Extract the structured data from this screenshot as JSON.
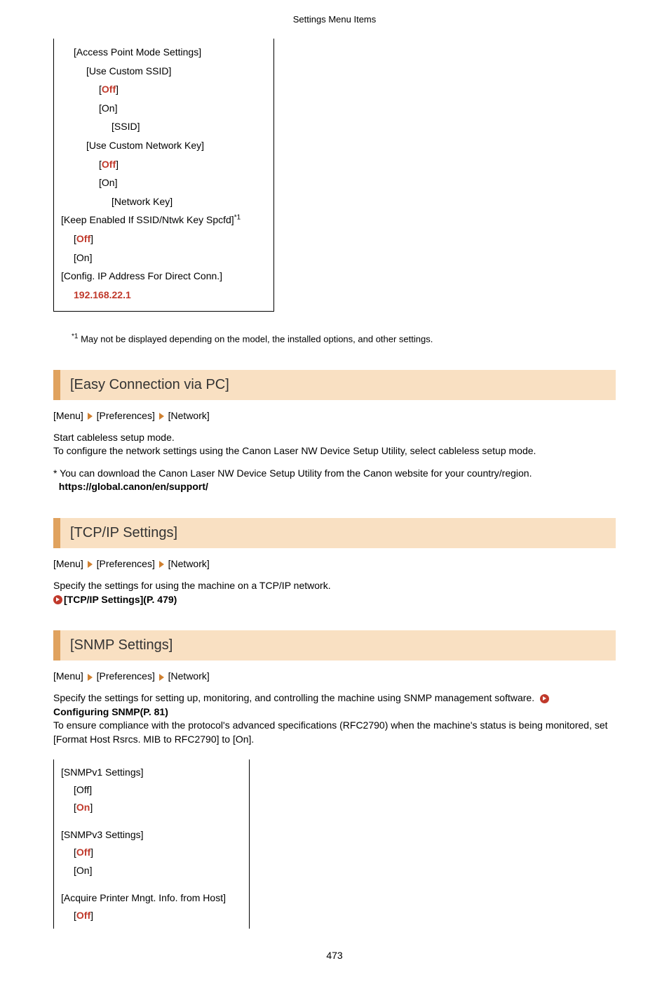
{
  "header": {
    "title": "Settings Menu Items"
  },
  "box1": {
    "l1": "[Access Point Mode Settings]",
    "l2": "[Use Custom SSID]",
    "l3a": "[",
    "l3b": "Off",
    "l3c": "]",
    "l4": "[On]",
    "l5": "[SSID]",
    "l6": "[Use Custom Network Key]",
    "l7a": "[",
    "l7b": "Off",
    "l7c": "]",
    "l8": "[On]",
    "l9": "[Network Key]",
    "l10a": "[Keep Enabled If SSID/Ntwk Key Spcfd]",
    "l10sup": "*1",
    "l11a": "[",
    "l11b": "Off",
    "l11c": "]",
    "l12": "[On]",
    "l13": "[Config. IP Address For Direct Conn.]",
    "l14": "192.168.22.1"
  },
  "footnote": {
    "sup": "*1",
    "text": " May not be displayed depending on the model, the installed options, and other settings."
  },
  "breadcrumb": {
    "a": "[Menu]",
    "b": "[Preferences]",
    "c": "[Network]"
  },
  "sec1": {
    "title": "[Easy Connection via PC]",
    "p1": "Start cableless setup mode.",
    "p2": "To configure the network settings using the Canon Laser NW Device Setup Utility, select cableless setup mode.",
    "p3": "* You can download the Canon Laser NW Device Setup Utility from the Canon website for your country/region.",
    "p4": "https://global.canon/en/support/"
  },
  "sec2": {
    "title": "[TCP/IP Settings]",
    "p1": "Specify the settings for using the machine on a TCP/IP network.",
    "link": "[TCP/IP Settings](P. 479)"
  },
  "sec3": {
    "title": "[SNMP Settings]",
    "p1a": "Specify the settings for setting up, monitoring, and controlling the machine using SNMP management software. ",
    "link": "Configuring SNMP(P. 81)",
    "p2": "To ensure compliance with the protocol's advanced specifications (RFC2790) when the machine's status is being monitored, set [Format Host Rsrcs. MIB to RFC2790] to [On]."
  },
  "box2": {
    "l1": "[SNMPv1 Settings]",
    "l2": "[Off]",
    "l3a": "[",
    "l3b": "On",
    "l3c": "]",
    "l4": "[SNMPv3 Settings]",
    "l5a": "[",
    "l5b": "Off",
    "l5c": "]",
    "l6": "[On]",
    "l7": "[Acquire Printer Mngt. Info. from Host]",
    "l8a": "[",
    "l8b": "Off",
    "l8c": "]"
  },
  "pageNumber": "473"
}
